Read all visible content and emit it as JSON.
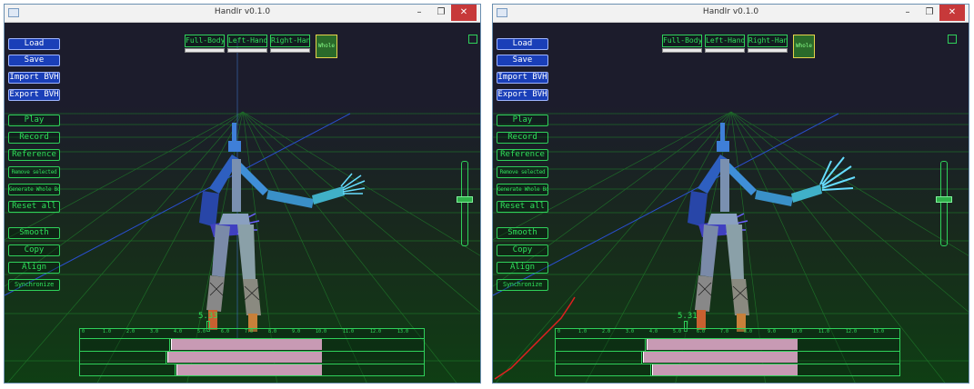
{
  "windows": [
    {
      "title": "HandIr v0.1.0",
      "controls": {
        "minimize": "–",
        "maximize": "❐",
        "close": "✕"
      },
      "file_buttons": [
        "Load",
        "Save",
        "Import BVH",
        "Export BVH"
      ],
      "action_buttons": [
        "Play",
        "Record",
        "Reference",
        "Remove selected",
        "Generate Whole Body",
        "Reset all"
      ],
      "edit_buttons": [
        "Smooth",
        "Copy",
        "Align",
        "Synchronize"
      ],
      "modes": [
        "Full-Body",
        "Left-Hand",
        "Right-Hand",
        "Whole"
      ],
      "selected_mode": "Whole",
      "current_time": "5.33",
      "ruler_ticks": [
        "0",
        "1.0",
        "2.0",
        "3.0",
        "4.0",
        "5.0",
        "6.0",
        "7.0",
        "8.0",
        "9.0",
        "10.0",
        "11.0",
        "12.0",
        "13.0"
      ],
      "slider_level": 0.45
    },
    {
      "title": "HandIr v0.1.0",
      "controls": {
        "minimize": "–",
        "maximize": "❐",
        "close": "✕"
      },
      "file_buttons": [
        "Load",
        "Save",
        "Import BVH",
        "Export BVH"
      ],
      "action_buttons": [
        "Play",
        "Record",
        "Reference",
        "Remove selected",
        "Generate Whole Body",
        "Reset all"
      ],
      "edit_buttons": [
        "Smooth",
        "Copy",
        "Align",
        "Synchronize"
      ],
      "modes": [
        "Full-Body",
        "Left-Hand",
        "Right-Hand",
        "Whole"
      ],
      "selected_mode": "Whole",
      "current_time": "5.31",
      "ruler_ticks": [
        "0",
        "1.0",
        "2.0",
        "3.0",
        "4.0",
        "5.0",
        "6.0",
        "7.0",
        "8.0",
        "9.0",
        "10.0",
        "11.0",
        "12.0",
        "13.0"
      ],
      "slider_level": 0.45
    }
  ],
  "colors": {
    "accent_green": "#2fe05a",
    "button_blue": "#1a3fb8",
    "clip_pink": "#c89ab4",
    "close_red": "#c7393a"
  }
}
